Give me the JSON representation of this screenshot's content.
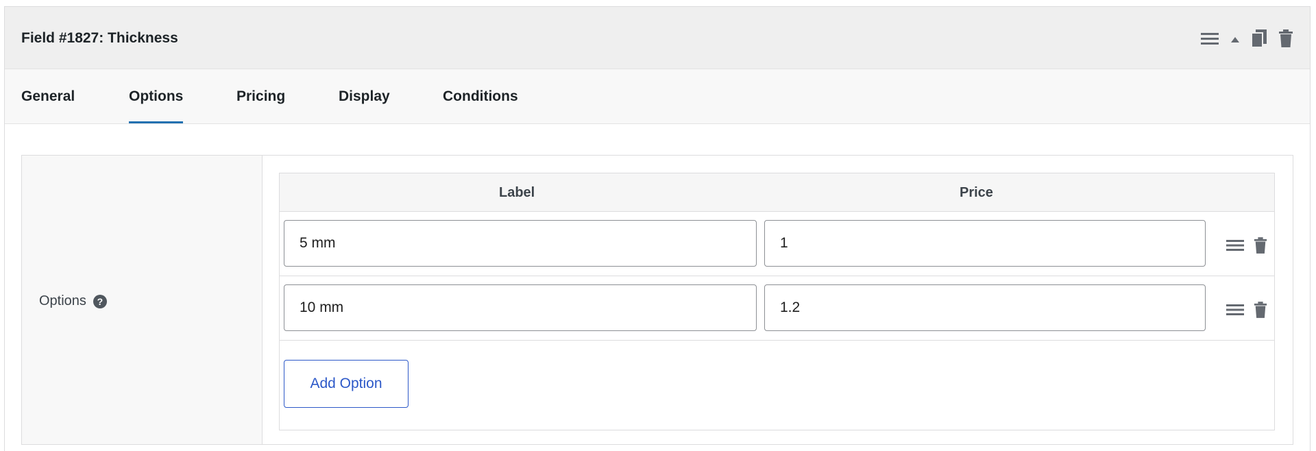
{
  "header": {
    "title": "Field #1827: Thickness",
    "actions": [
      {
        "icon": "menu-icon"
      },
      {
        "icon": "collapse-up-icon"
      },
      {
        "icon": "duplicate-icon"
      },
      {
        "icon": "trash-icon"
      }
    ]
  },
  "tabs": [
    {
      "label": "General",
      "active": false
    },
    {
      "label": "Options",
      "active": true
    },
    {
      "label": "Pricing",
      "active": false
    },
    {
      "label": "Display",
      "active": false
    },
    {
      "label": "Conditions",
      "active": false
    }
  ],
  "options_section": {
    "label": "Options",
    "help_icon": "help-icon"
  },
  "table": {
    "columns": [
      "Label",
      "Price"
    ],
    "rows": [
      {
        "label": "5 mm",
        "price": "1"
      },
      {
        "label": "10 mm",
        "price": "1.2"
      }
    ],
    "add_label": "Add Option"
  },
  "colors": {
    "accent": "#2271b1",
    "button": "#2c58c8",
    "header_bg": "#efefef"
  }
}
